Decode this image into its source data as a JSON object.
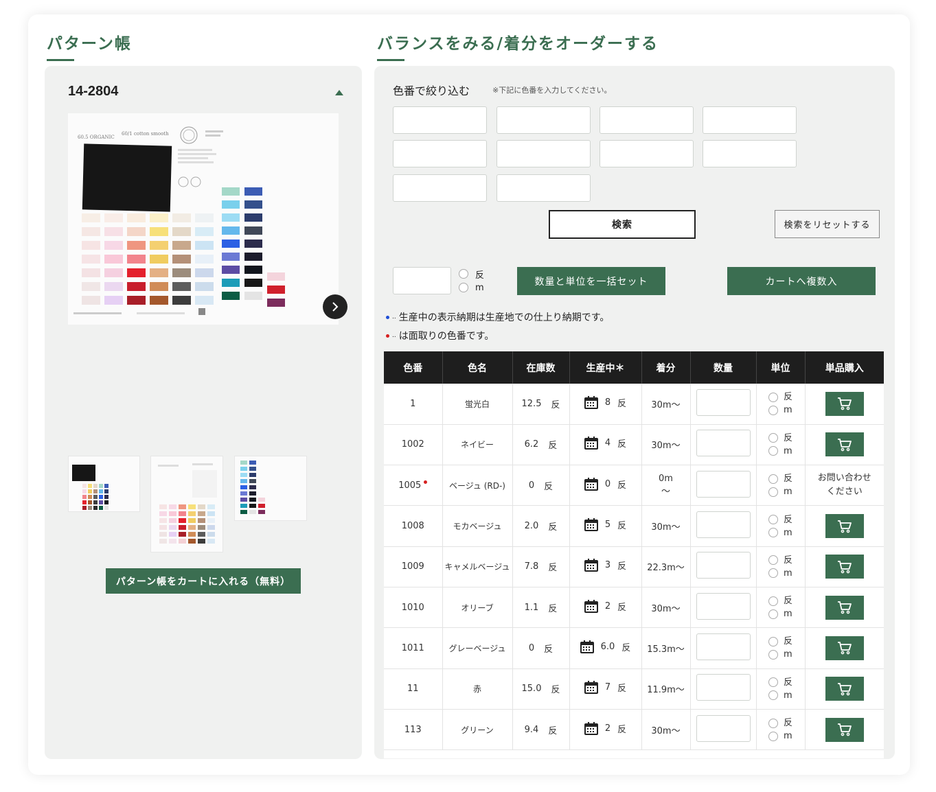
{
  "left": {
    "title": "パターン帳",
    "pattern_id": "14-2804",
    "main_image_texts": [
      "60/1 cotton smooth",
      "60.5 ORGANIC"
    ],
    "add_pattern_book_button": "パターン帳をカートに入れる（無料）"
  },
  "right": {
    "title": "バランスをみる/着分をオーダーする",
    "filter_label": "色番で絞り込む",
    "filter_note": "※下記に色番を入力してください。",
    "search_button": "検索",
    "reset_button": "検索をリセットする",
    "unit_options": [
      "反",
      "m"
    ],
    "bulk_set_button": "数量と単位を一括セット",
    "bulk_cart_button": "カートへ複数入",
    "notes": [
      {
        "dot_color": "#1f4fd6",
        "text": "生産中の表示納期は生産地での仕上り納期です。"
      },
      {
        "dot_color": "#d62020",
        "text": "は面取りの色番です。"
      }
    ]
  },
  "table": {
    "headers": [
      "色番",
      "色名",
      "在庫数",
      "生産中＊",
      "着分",
      "数量",
      "単位",
      "単品購入"
    ],
    "unit_labels": [
      "反",
      "m"
    ],
    "rows": [
      {
        "code": "1",
        "name": "蛍光白",
        "stock": "12.5",
        "stock_unit": "反",
        "prod": "8",
        "prod_unit": "反",
        "cut": "30m〜",
        "buy": "cart"
      },
      {
        "code": "1002",
        "name": "ネイビー",
        "stock": "6.2",
        "stock_unit": "反",
        "prod": "4",
        "prod_unit": "反",
        "cut": "30m〜",
        "buy": "cart"
      },
      {
        "code": "1005",
        "name": "ベージュ (RD-)",
        "stock": "0",
        "stock_unit": "反",
        "prod": "0",
        "prod_unit": "反",
        "cut": "0m\n〜",
        "buy": "inquiry",
        "inquiry_text": "お問い合わせ\nください",
        "red_dot": true
      },
      {
        "code": "1008",
        "name": "モカベージュ",
        "stock": "2.0",
        "stock_unit": "反",
        "prod": "5",
        "prod_unit": "反",
        "cut": "30m〜",
        "buy": "cart"
      },
      {
        "code": "1009",
        "name": "キャメルベージュ",
        "stock": "7.8",
        "stock_unit": "反",
        "prod": "3",
        "prod_unit": "反",
        "cut": "22.3m〜",
        "buy": "cart"
      },
      {
        "code": "1010",
        "name": "オリーブ",
        "stock": "1.1",
        "stock_unit": "反",
        "prod": "2",
        "prod_unit": "反",
        "cut": "30m〜",
        "buy": "cart"
      },
      {
        "code": "1011",
        "name": "グレーベージュ",
        "stock": "0",
        "stock_unit": "反",
        "prod": "6.0",
        "prod_unit": "反",
        "cut": "15.3m〜",
        "buy": "cart"
      },
      {
        "code": "11",
        "name": "赤",
        "stock": "15.0",
        "stock_unit": "反",
        "prod": "7",
        "prod_unit": "反",
        "cut": "11.9m〜",
        "buy": "cart"
      },
      {
        "code": "113",
        "name": "グリーン",
        "stock": "9.4",
        "stock_unit": "反",
        "prod": "2",
        "prod_unit": "反",
        "cut": "30m〜",
        "buy": "cart"
      }
    ]
  },
  "colors": {
    "brand_green": "#3b6e51",
    "header_dark": "#1e1e1e",
    "panel_bg": "#f0f1f0"
  }
}
